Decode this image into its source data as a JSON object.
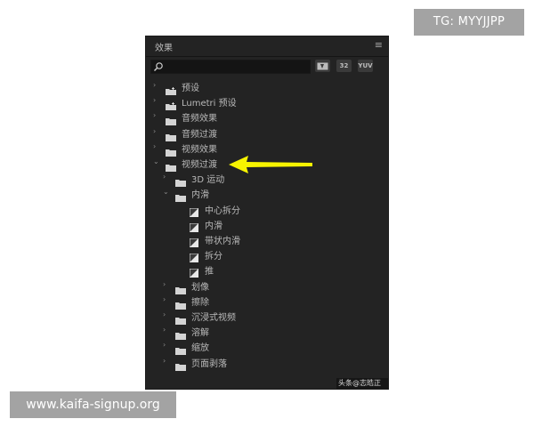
{
  "tg_label": "TG: MYYJJPP",
  "site_label": "www.kaifa-signup.org",
  "panel": {
    "title": "效果",
    "menu_icon": "hamburger-icon",
    "search": {
      "placeholder": "",
      "value": ""
    },
    "filter_buttons": [
      "accelerated-effects-icon",
      "32",
      "YUV"
    ]
  },
  "tree": [
    {
      "label": "预设",
      "type": "preset-folder",
      "expanded": false
    },
    {
      "label": "Lumetri 预设",
      "type": "preset-folder",
      "expanded": false
    },
    {
      "label": "音频效果",
      "type": "folder",
      "expanded": false
    },
    {
      "label": "音频过渡",
      "type": "folder",
      "expanded": false
    },
    {
      "label": "视频效果",
      "type": "folder",
      "expanded": false
    },
    {
      "label": "视频过渡",
      "type": "folder",
      "expanded": true
    },
    {
      "label": "3D 运动",
      "type": "folder",
      "expanded": false
    },
    {
      "label": "内滑",
      "type": "folder",
      "expanded": true
    },
    {
      "label": "中心拆分",
      "type": "effect"
    },
    {
      "label": "内滑",
      "type": "effect"
    },
    {
      "label": "带状内滑",
      "type": "effect"
    },
    {
      "label": "拆分",
      "type": "effect"
    },
    {
      "label": "推",
      "type": "effect"
    },
    {
      "label": "划像",
      "type": "folder",
      "expanded": false
    },
    {
      "label": "擦除",
      "type": "folder",
      "expanded": false
    },
    {
      "label": "沉浸式视频",
      "type": "folder",
      "expanded": false
    },
    {
      "label": "溶解",
      "type": "folder",
      "expanded": false
    },
    {
      "label": "缩放",
      "type": "folder",
      "expanded": false
    },
    {
      "label": "页面剥落",
      "type": "folder",
      "expanded": false
    }
  ],
  "watermark": "头条@志皓正德",
  "colors": {
    "panel_bg": "#232323",
    "text": "#b9b9b9",
    "arrow": "#f7f400"
  }
}
